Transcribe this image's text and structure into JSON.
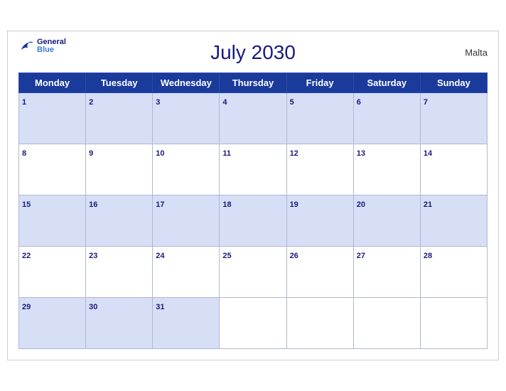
{
  "calendar": {
    "title": "July 2030",
    "country": "Malta",
    "logo": {
      "general": "General",
      "blue": "Blue"
    },
    "days_of_week": [
      "Monday",
      "Tuesday",
      "Wednesday",
      "Thursday",
      "Friday",
      "Saturday",
      "Sunday"
    ],
    "weeks": [
      [
        1,
        2,
        3,
        4,
        5,
        6,
        7
      ],
      [
        8,
        9,
        10,
        11,
        12,
        13,
        14
      ],
      [
        15,
        16,
        17,
        18,
        19,
        20,
        21
      ],
      [
        22,
        23,
        24,
        25,
        26,
        27,
        28
      ],
      [
        29,
        30,
        31,
        null,
        null,
        null,
        null
      ]
    ]
  }
}
